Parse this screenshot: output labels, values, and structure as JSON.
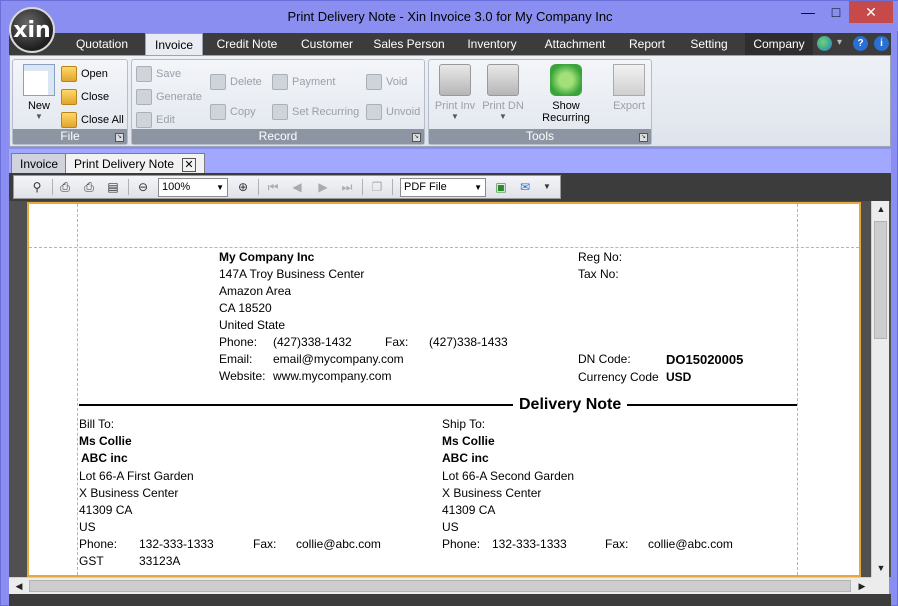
{
  "window": {
    "title": "Print Delivery Note - Xin Invoice 3.0 for My Company Inc",
    "logo_text": "xin",
    "minimize": "—",
    "maximize": "□",
    "close": "✕"
  },
  "ribbon_tabs": [
    "Quotation",
    "Invoice",
    "Credit Note",
    "Customer",
    "Sales Person",
    "Inventory",
    "Attachment",
    "Report",
    "Setting",
    "Company"
  ],
  "ribbon": {
    "file_group": {
      "label": "File",
      "new": "New",
      "open": "Open",
      "close": "Close",
      "close_all": "Close All"
    },
    "record_group": {
      "label": "Record",
      "save": "Save",
      "generate": "Generate",
      "edit": "Edit",
      "delete": "Delete",
      "copy": "Copy",
      "payment": "Payment",
      "set_recurring": "Set Recurring",
      "void": "Void",
      "unvoid": "Unvoid"
    },
    "tools_group": {
      "label": "Tools",
      "print_inv": "Print Inv",
      "print_dn": "Print DN",
      "show_recurring": "Show Recurring",
      "export": "Export"
    }
  },
  "doc_tabs": {
    "invoice": "Invoice",
    "print_delivery_note": "Print Delivery Note",
    "close": "✕"
  },
  "viewer_toolbar": {
    "zoom": "100%",
    "format": "PDF File"
  },
  "document": {
    "company": {
      "name": "My Company Inc",
      "address1": "147A Troy Business Center",
      "address2": "Amazon Area",
      "address3": "CA 18520",
      "country": "United State",
      "phone_label": "Phone:",
      "phone": "(427)338-1432",
      "fax_label": "Fax:",
      "fax": "(427)338-1433",
      "email_label": "Email:",
      "email": "email@mycompany.com",
      "website_label": "Website:",
      "website": "www.mycompany.com"
    },
    "reg_no_label": "Reg No:",
    "tax_no_label": "Tax No:",
    "dn_code_label": "DN Code:",
    "dn_code": "DO15020005",
    "currency_code_label": "Currency Code",
    "currency_code": "USD",
    "title": "Delivery Note",
    "bill_to": {
      "label": "Bill To:",
      "contact": "Ms Collie",
      "company": "ABC inc",
      "address1": "Lot 66-A First Garden",
      "address2": "X Business Center",
      "address3": "41309 CA",
      "country": "US",
      "phone_label": "Phone:",
      "phone": "132-333-1333",
      "fax_label": "Fax:",
      "fax": "collie@abc.com",
      "gst_label": "GST",
      "gst": "33123A"
    },
    "ship_to": {
      "label": "Ship To:",
      "contact": "Ms Collie",
      "company": "ABC inc",
      "address1": "Lot 66-A Second Garden",
      "address2": "X Business Center",
      "address3": "41309 CA",
      "country": "US",
      "phone_label": "Phone:",
      "phone": "132-333-1333",
      "fax_label": "Fax:",
      "fax": "collie@abc.com"
    }
  }
}
